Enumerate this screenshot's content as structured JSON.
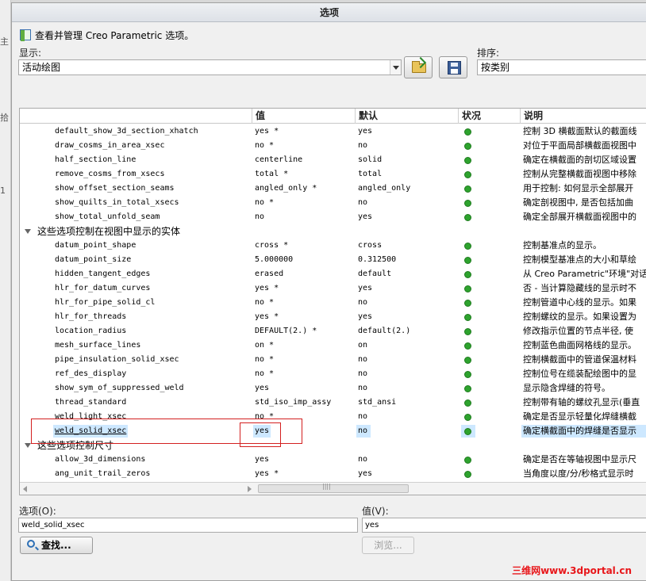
{
  "dialog": {
    "title": "选项"
  },
  "info": {
    "text": "查看并管理 Creo Parametric 选项。"
  },
  "display": {
    "label": "显示:",
    "value": "活动绘图"
  },
  "sort": {
    "label": "排序:",
    "value": "按类别"
  },
  "toolbar": {
    "open_icon": "folder-open-icon",
    "save_icon": "save-icon"
  },
  "table": {
    "headers": {
      "name": "",
      "value": "值",
      "default": "默认",
      "status": "状况",
      "desc": "说明"
    },
    "rows": [
      {
        "name": "default_show_3d_section_xhatch",
        "value": "yes *",
        "default": "yes",
        "desc": "控制 3D 横截面默认的截面线"
      },
      {
        "name": "draw_cosms_in_area_xsec",
        "value": "no *",
        "default": "no",
        "desc": "对位于平面局部横截面视图中"
      },
      {
        "name": "half_section_line",
        "value": "centerline",
        "default": "solid",
        "desc": "确定在横截面的剖切区域设置"
      },
      {
        "name": "remove_cosms_from_xsecs",
        "value": "total *",
        "default": "total",
        "desc": "控制从完整横截面视图中移除"
      },
      {
        "name": "show_offset_section_seams",
        "value": "angled_only *",
        "default": "angled_only",
        "desc": "用于控制: 如何显示全部展开"
      },
      {
        "name": "show_quilts_in_total_xsecs",
        "value": "no *",
        "default": "no",
        "desc": "确定剖视图中, 是否包括加曲"
      },
      {
        "name": "show_total_unfold_seam",
        "value": "no",
        "default": "yes",
        "desc": "确定全部展开横截面视图中的"
      }
    ],
    "group2": "这些选项控制在视图中显示的实体",
    "rows2": [
      {
        "name": "datum_point_shape",
        "value": "cross *",
        "default": "cross",
        "desc": "控制基准点的显示。"
      },
      {
        "name": "datum_point_size",
        "value": "5.000000",
        "default": "0.312500",
        "desc": "控制模型基准点的大小和草绘"
      },
      {
        "name": "hidden_tangent_edges",
        "value": "erased",
        "default": "default",
        "desc": "从 Creo Parametric\"环境\"对话"
      },
      {
        "name": "hlr_for_datum_curves",
        "value": "yes *",
        "default": "yes",
        "desc": "否 - 当计算隐藏线的显示时不"
      },
      {
        "name": "hlr_for_pipe_solid_cl",
        "value": "no *",
        "default": "no",
        "desc": "控制管道中心线的显示。如果"
      },
      {
        "name": "hlr_for_threads",
        "value": "yes *",
        "default": "yes",
        "desc": "控制螺纹的显示。如果设置为"
      },
      {
        "name": "location_radius",
        "value": "DEFAULT(2.) *",
        "default": "default(2.)",
        "desc": "修改指示位置的节点半径, 使"
      },
      {
        "name": "mesh_surface_lines",
        "value": "on *",
        "default": "on",
        "desc": "控制蓝色曲面网格线的显示。"
      },
      {
        "name": "pipe_insulation_solid_xsec",
        "value": "no *",
        "default": "no",
        "desc": "控制横截面中的管道保温材料"
      },
      {
        "name": "ref_des_display",
        "value": "no *",
        "default": "no",
        "desc": "控制位号在缆装配绘图中的显"
      },
      {
        "name": "show_sym_of_suppressed_weld",
        "value": "yes",
        "default": "no",
        "desc": "显示隐含焊缝的符号。"
      },
      {
        "name": "thread_standard",
        "value": "std_iso_imp_assy",
        "default": "std_ansi",
        "desc": "控制带有轴的螺纹孔显示(垂直"
      },
      {
        "name": "weld_light_xsec",
        "value": "no *",
        "default": "no",
        "desc": "确定是否显示轻量化焊缝横截"
      },
      {
        "name": "weld_solid_xsec",
        "value": "yes",
        "default": "no",
        "desc": "确定横截面中的焊缝是否显示"
      }
    ],
    "group3": "这些选项控制尺寸",
    "rows3": [
      {
        "name": "allow_3d_dimensions",
        "value": "yes",
        "default": "no",
        "desc": "确定是否在等轴视图中显示尺"
      },
      {
        "name": "ang_unit_trail_zeros",
        "value": "yes *",
        "default": "yes",
        "desc": "当角度以度/分/秒格式显示时"
      }
    ]
  },
  "option_field": {
    "label": "选项(O):",
    "value": "weld_solid_xsec"
  },
  "value_field": {
    "label": "值(V):",
    "value": "yes"
  },
  "buttons": {
    "find": "查找...",
    "browse": "浏览..."
  },
  "left_strip": [
    "主",
    "拾",
    "1"
  ],
  "watermark": "三维网www.3dportal.cn"
}
